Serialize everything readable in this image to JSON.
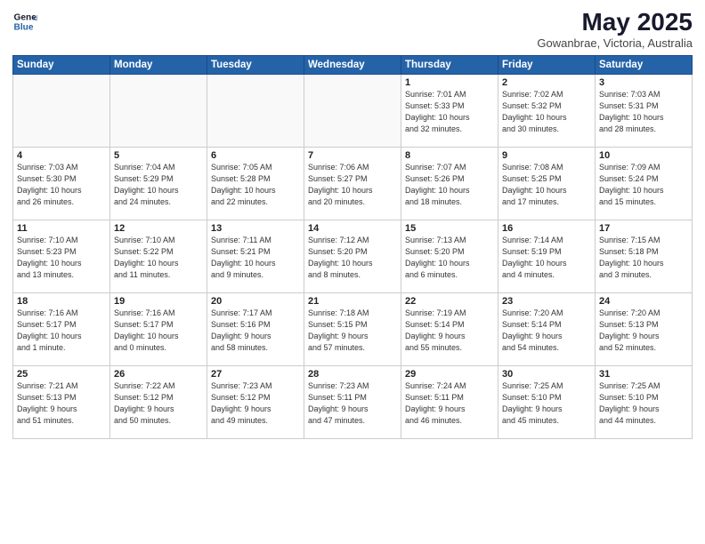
{
  "header": {
    "logo_line1": "General",
    "logo_line2": "Blue",
    "title": "May 2025",
    "subtitle": "Gowanbrae, Victoria, Australia"
  },
  "weekdays": [
    "Sunday",
    "Monday",
    "Tuesday",
    "Wednesday",
    "Thursday",
    "Friday",
    "Saturday"
  ],
  "weeks": [
    [
      {
        "day": "",
        "info": ""
      },
      {
        "day": "",
        "info": ""
      },
      {
        "day": "",
        "info": ""
      },
      {
        "day": "",
        "info": ""
      },
      {
        "day": "1",
        "info": "Sunrise: 7:01 AM\nSunset: 5:33 PM\nDaylight: 10 hours\nand 32 minutes."
      },
      {
        "day": "2",
        "info": "Sunrise: 7:02 AM\nSunset: 5:32 PM\nDaylight: 10 hours\nand 30 minutes."
      },
      {
        "day": "3",
        "info": "Sunrise: 7:03 AM\nSunset: 5:31 PM\nDaylight: 10 hours\nand 28 minutes."
      }
    ],
    [
      {
        "day": "4",
        "info": "Sunrise: 7:03 AM\nSunset: 5:30 PM\nDaylight: 10 hours\nand 26 minutes."
      },
      {
        "day": "5",
        "info": "Sunrise: 7:04 AM\nSunset: 5:29 PM\nDaylight: 10 hours\nand 24 minutes."
      },
      {
        "day": "6",
        "info": "Sunrise: 7:05 AM\nSunset: 5:28 PM\nDaylight: 10 hours\nand 22 minutes."
      },
      {
        "day": "7",
        "info": "Sunrise: 7:06 AM\nSunset: 5:27 PM\nDaylight: 10 hours\nand 20 minutes."
      },
      {
        "day": "8",
        "info": "Sunrise: 7:07 AM\nSunset: 5:26 PM\nDaylight: 10 hours\nand 18 minutes."
      },
      {
        "day": "9",
        "info": "Sunrise: 7:08 AM\nSunset: 5:25 PM\nDaylight: 10 hours\nand 17 minutes."
      },
      {
        "day": "10",
        "info": "Sunrise: 7:09 AM\nSunset: 5:24 PM\nDaylight: 10 hours\nand 15 minutes."
      }
    ],
    [
      {
        "day": "11",
        "info": "Sunrise: 7:10 AM\nSunset: 5:23 PM\nDaylight: 10 hours\nand 13 minutes."
      },
      {
        "day": "12",
        "info": "Sunrise: 7:10 AM\nSunset: 5:22 PM\nDaylight: 10 hours\nand 11 minutes."
      },
      {
        "day": "13",
        "info": "Sunrise: 7:11 AM\nSunset: 5:21 PM\nDaylight: 10 hours\nand 9 minutes."
      },
      {
        "day": "14",
        "info": "Sunrise: 7:12 AM\nSunset: 5:20 PM\nDaylight: 10 hours\nand 8 minutes."
      },
      {
        "day": "15",
        "info": "Sunrise: 7:13 AM\nSunset: 5:20 PM\nDaylight: 10 hours\nand 6 minutes."
      },
      {
        "day": "16",
        "info": "Sunrise: 7:14 AM\nSunset: 5:19 PM\nDaylight: 10 hours\nand 4 minutes."
      },
      {
        "day": "17",
        "info": "Sunrise: 7:15 AM\nSunset: 5:18 PM\nDaylight: 10 hours\nand 3 minutes."
      }
    ],
    [
      {
        "day": "18",
        "info": "Sunrise: 7:16 AM\nSunset: 5:17 PM\nDaylight: 10 hours\nand 1 minute."
      },
      {
        "day": "19",
        "info": "Sunrise: 7:16 AM\nSunset: 5:17 PM\nDaylight: 10 hours\nand 0 minutes."
      },
      {
        "day": "20",
        "info": "Sunrise: 7:17 AM\nSunset: 5:16 PM\nDaylight: 9 hours\nand 58 minutes."
      },
      {
        "day": "21",
        "info": "Sunrise: 7:18 AM\nSunset: 5:15 PM\nDaylight: 9 hours\nand 57 minutes."
      },
      {
        "day": "22",
        "info": "Sunrise: 7:19 AM\nSunset: 5:14 PM\nDaylight: 9 hours\nand 55 minutes."
      },
      {
        "day": "23",
        "info": "Sunrise: 7:20 AM\nSunset: 5:14 PM\nDaylight: 9 hours\nand 54 minutes."
      },
      {
        "day": "24",
        "info": "Sunrise: 7:20 AM\nSunset: 5:13 PM\nDaylight: 9 hours\nand 52 minutes."
      }
    ],
    [
      {
        "day": "25",
        "info": "Sunrise: 7:21 AM\nSunset: 5:13 PM\nDaylight: 9 hours\nand 51 minutes."
      },
      {
        "day": "26",
        "info": "Sunrise: 7:22 AM\nSunset: 5:12 PM\nDaylight: 9 hours\nand 50 minutes."
      },
      {
        "day": "27",
        "info": "Sunrise: 7:23 AM\nSunset: 5:12 PM\nDaylight: 9 hours\nand 49 minutes."
      },
      {
        "day": "28",
        "info": "Sunrise: 7:23 AM\nSunset: 5:11 PM\nDaylight: 9 hours\nand 47 minutes."
      },
      {
        "day": "29",
        "info": "Sunrise: 7:24 AM\nSunset: 5:11 PM\nDaylight: 9 hours\nand 46 minutes."
      },
      {
        "day": "30",
        "info": "Sunrise: 7:25 AM\nSunset: 5:10 PM\nDaylight: 9 hours\nand 45 minutes."
      },
      {
        "day": "31",
        "info": "Sunrise: 7:25 AM\nSunset: 5:10 PM\nDaylight: 9 hours\nand 44 minutes."
      }
    ]
  ]
}
